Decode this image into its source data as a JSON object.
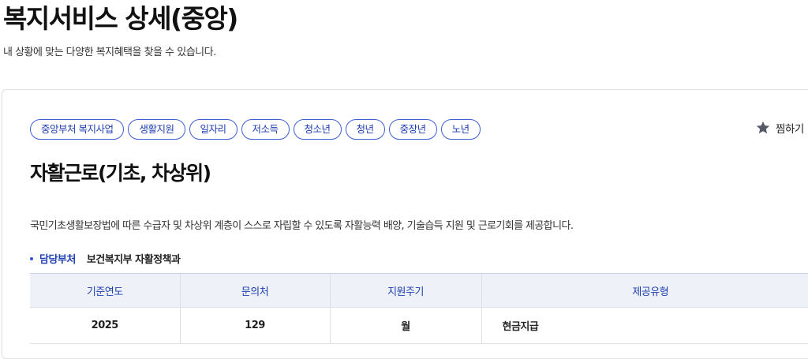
{
  "header": {
    "title": "복지서비스 상세(중앙)",
    "subtitle": "내 상황에 맞는 다양한 복지혜택을 찾을 수 있습니다."
  },
  "tags": [
    "중앙부처 복지사업",
    "생활지원",
    "일자리",
    "저소득",
    "청소년",
    "청년",
    "중장년",
    "노년"
  ],
  "bookmark": {
    "label": "찜하기",
    "icon": "star-icon"
  },
  "service": {
    "title": "자활근로(기초, 차상위)",
    "description": "국민기초생활보장법에 따른 수급자 및 차상위 계층이 스스로 자립할 수 있도록 자활능력 배양, 기술습득 지원 및 근로기회를 제공합니다.",
    "department_label": "담당부처",
    "department_value": "보건복지부 자활정책과"
  },
  "table": {
    "headers": [
      "기준연도",
      "문의처",
      "지원주기",
      "제공유형"
    ],
    "rows": [
      [
        "2025",
        "129",
        "월",
        "현금지급"
      ]
    ]
  },
  "colors": {
    "accent": "#1e3fb0",
    "tag_border": "#3d5fd6",
    "table_header_bg": "#eef1f8"
  }
}
